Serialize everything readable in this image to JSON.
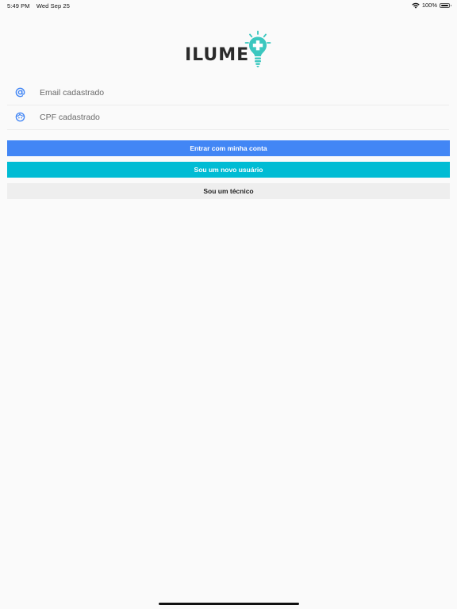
{
  "status_bar": {
    "time": "5:49 PM",
    "date": "Wed Sep 25",
    "battery": "100%"
  },
  "logo": {
    "text": "ILUME"
  },
  "form": {
    "email_placeholder": "Email cadastrado",
    "cpf_placeholder": "CPF cadastrado"
  },
  "buttons": {
    "login": "Entrar com minha conta",
    "new_user": "Sou um novo usuário",
    "technician": "Sou um técnico"
  },
  "colors": {
    "primary_blue": "#4286f5",
    "teal": "#00bcd4",
    "light_gray": "#eeeeee",
    "logo_teal": "#3bc7bf"
  }
}
